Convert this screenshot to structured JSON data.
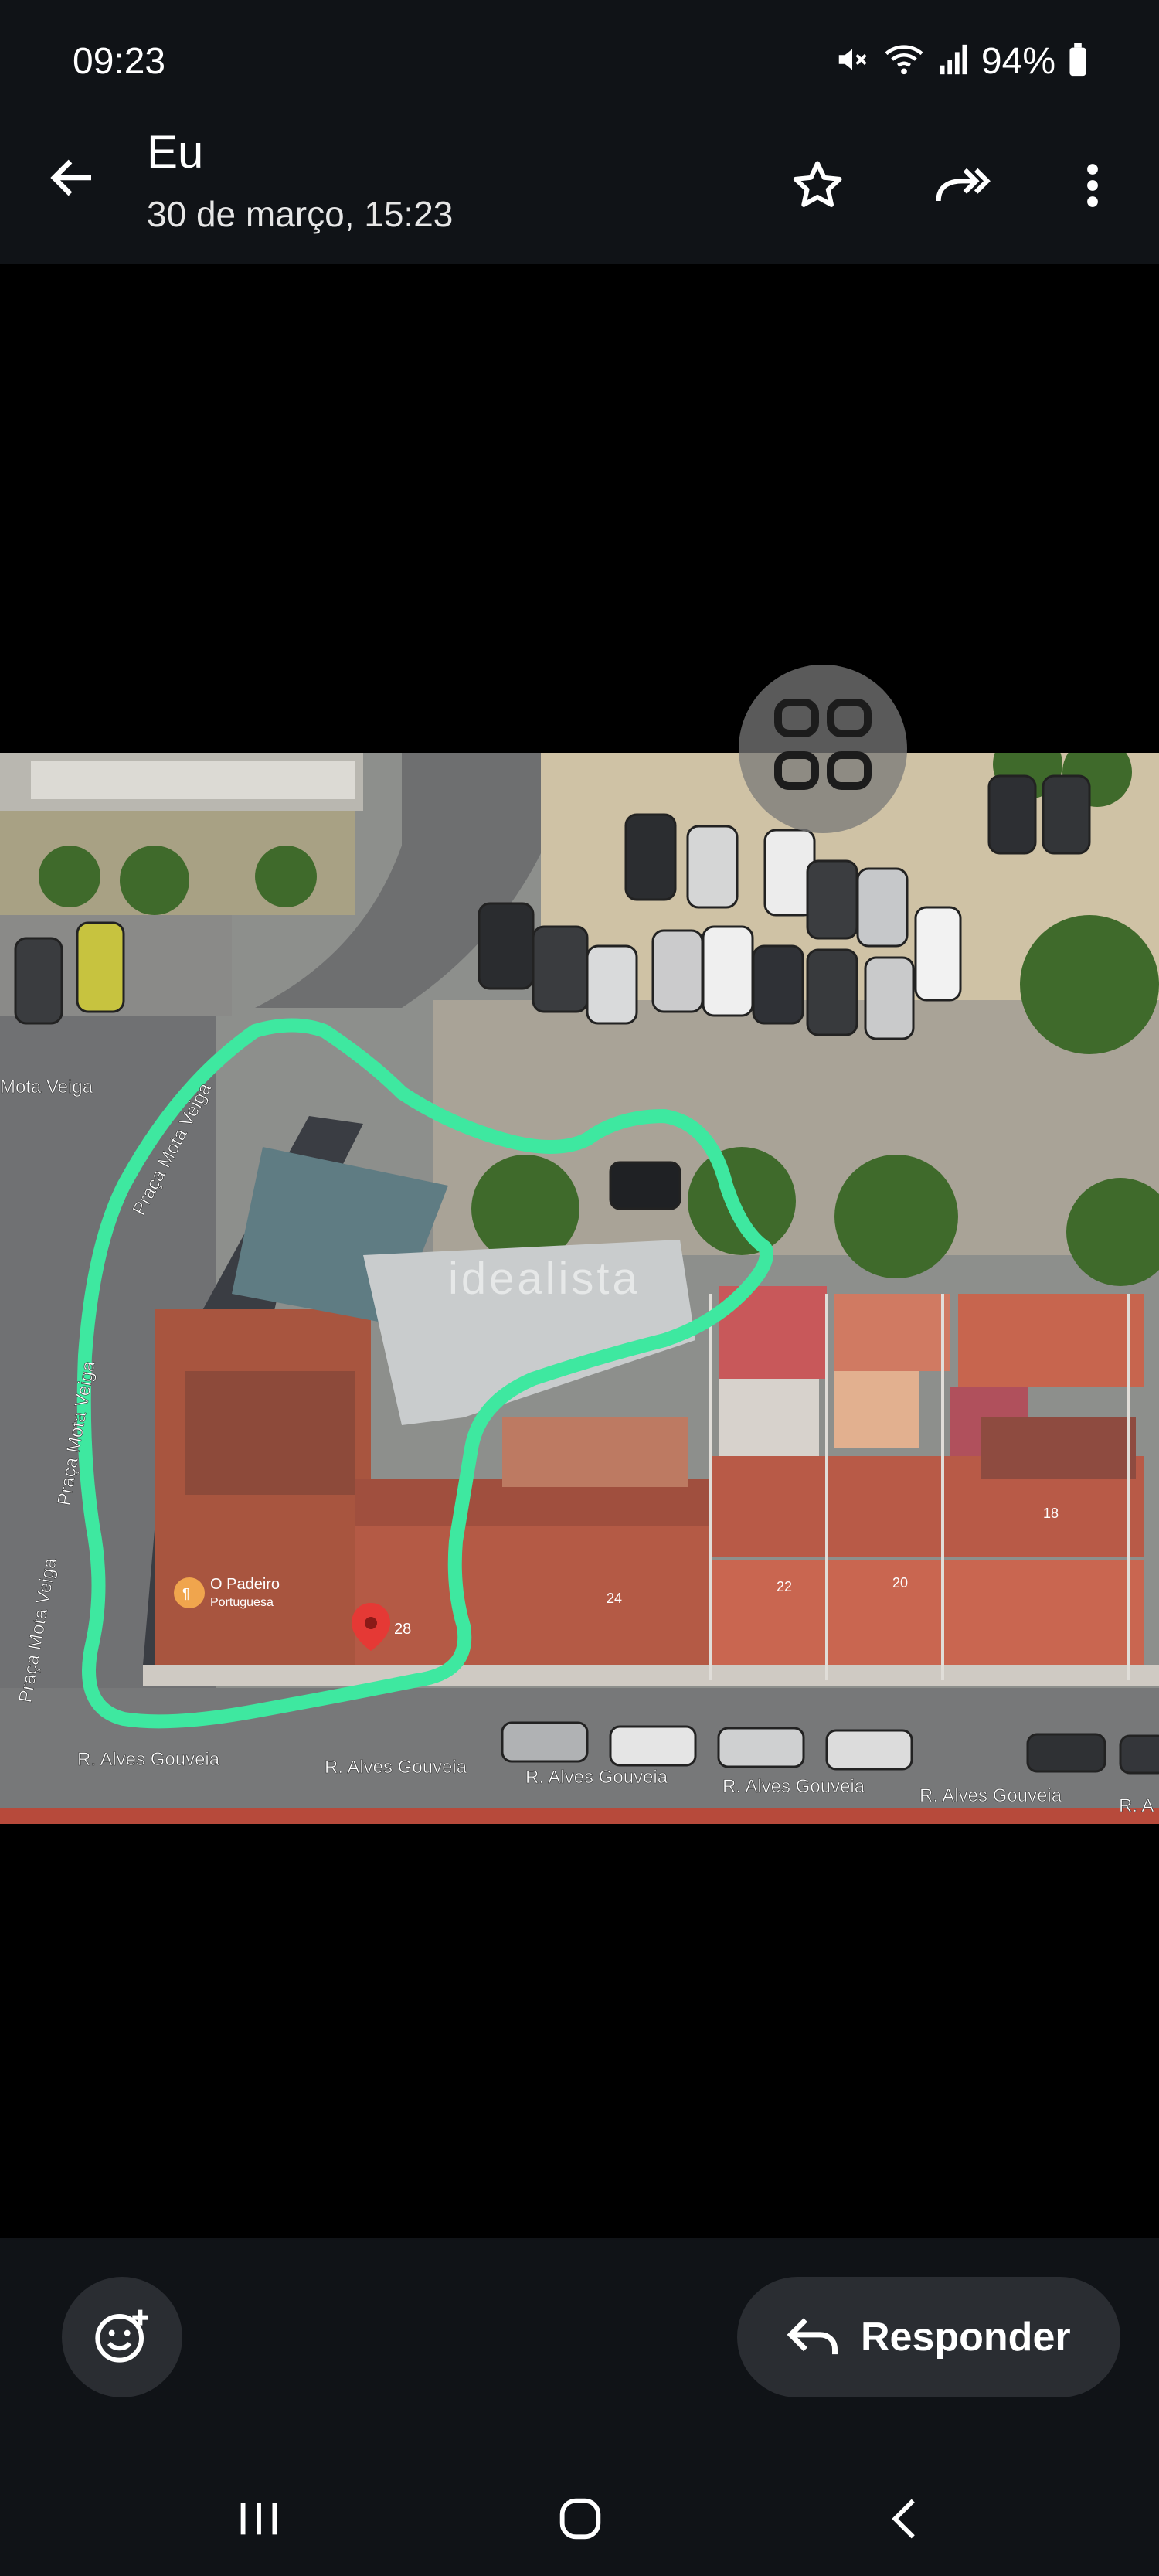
{
  "status_bar": {
    "time": "09:23",
    "battery": "94%",
    "icons": [
      "mute-icon",
      "wifi-icon",
      "signal-icon",
      "battery-icon"
    ]
  },
  "header": {
    "sender": "Eu",
    "date": "30 de março, 15:23",
    "icons": [
      "back-arrow-icon",
      "star-icon",
      "forward-icon",
      "more-vertical-icon"
    ]
  },
  "map": {
    "street_plaza_1": "Praça Mota Veiga",
    "street_plaza_2": "Praça Mota Veiga",
    "street_plaza_3": "Praça Mota Veiga",
    "street_plaza_4": "Mota Veiga",
    "street_rua_1": "R. Alves Gouveia",
    "street_rua_2": "R. Alves Gouveia",
    "street_rua_3": "R. Alves Gouveia",
    "street_rua_4": "R. Alves Gouveia",
    "street_rua_5": "R. Alves Gouveia",
    "street_rua_6": "R. A",
    "poi_name": "O Padeiro",
    "poi_sub": "Portuguesa",
    "pin_label": "28",
    "num_24": "24",
    "num_22": "22",
    "num_20": "20",
    "num_18": "18",
    "watermark": "idealista",
    "outline_color": "#3ee8a0"
  },
  "reply": {
    "label": "Responder",
    "icons": [
      "emoji-add-icon",
      "reply-arrow-icon"
    ]
  },
  "nav": {
    "icons": [
      "recents-icon",
      "home-icon",
      "nav-back-icon"
    ]
  }
}
